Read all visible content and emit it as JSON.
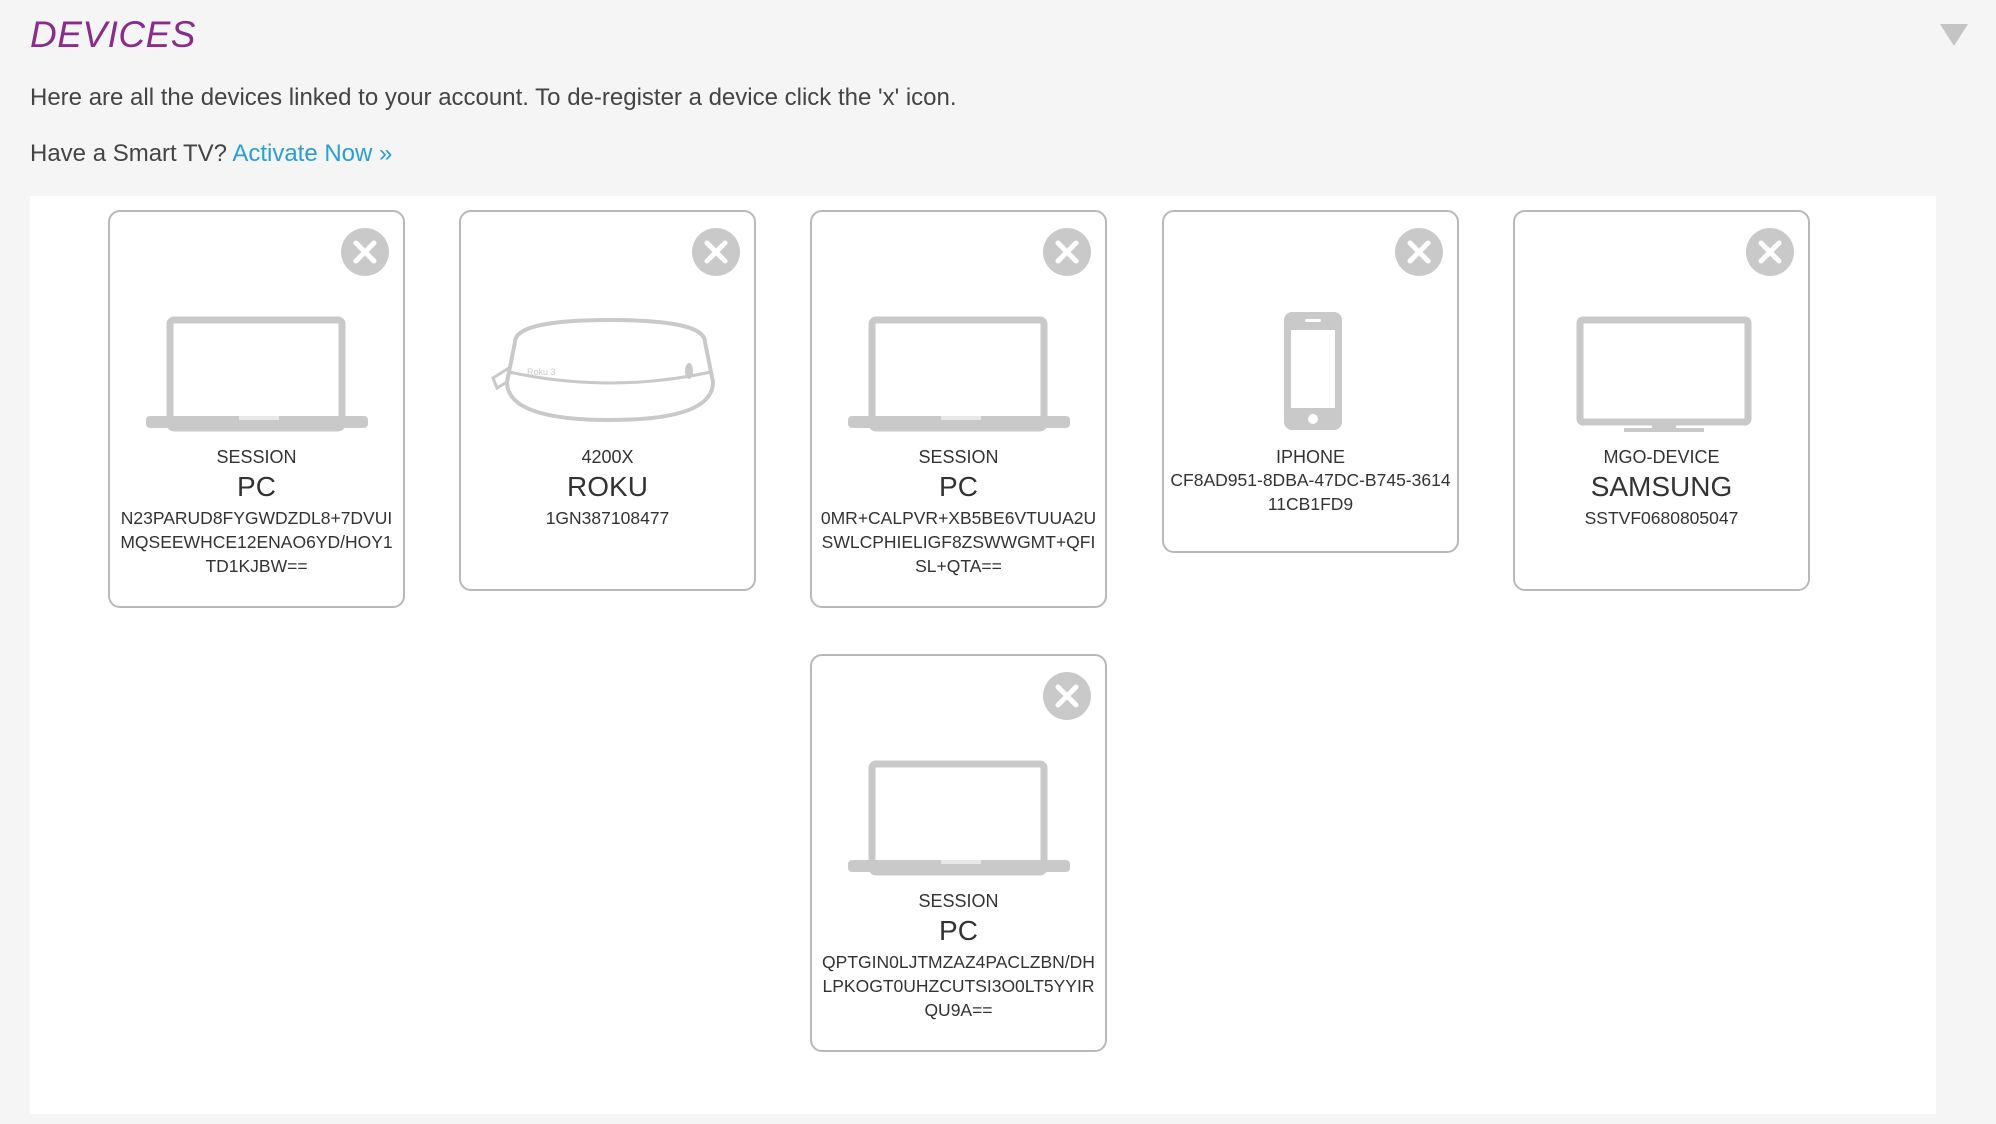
{
  "header": {
    "title": "DEVICES"
  },
  "intro_text": "Here are all the devices linked to your account. To de-register a device click the 'x' icon.",
  "smart_tv": {
    "prompt": "Have a Smart TV?",
    "link_label": "Activate Now »"
  },
  "devices": [
    {
      "icon": "laptop-icon",
      "type": "SESSION",
      "name": "PC",
      "id": "N23PARUD8FYGWDZDL8+7DVUIMQSEEWHCE12ENAO6YD/HOY1TD1KJBW=="
    },
    {
      "icon": "roku-box-icon",
      "type": "4200X",
      "name": "ROKU",
      "id": "1GN387108477"
    },
    {
      "icon": "laptop-icon",
      "type": "SESSION",
      "name": "PC",
      "id": "0MR+CALPVR+XB5BE6VTUUA2USWLCPHIELIGF8ZSWWGMT+QFISL+QTA=="
    },
    {
      "icon": "smartphone-icon",
      "type": "IPHONE",
      "name": "",
      "id": "CF8AD951-8DBA-47DC-B745-361411CB1FD9"
    },
    {
      "icon": "tv-monitor-icon",
      "type": "MGO-DEVICE",
      "name": "SAMSUNG",
      "id": "SSTVF0680805047"
    },
    {
      "icon": "laptop-icon",
      "type": "SESSION",
      "name": "PC",
      "id": "QPTGIN0LJTMZAZ4PACLZBN/DHLPKOGT0UHZCUTSI3O0LT5YYIRQU9A=="
    }
  ],
  "colors": {
    "title": "#8a2c8c",
    "link": "#2a9fd6",
    "icon_gray": "#c9c9c9"
  }
}
